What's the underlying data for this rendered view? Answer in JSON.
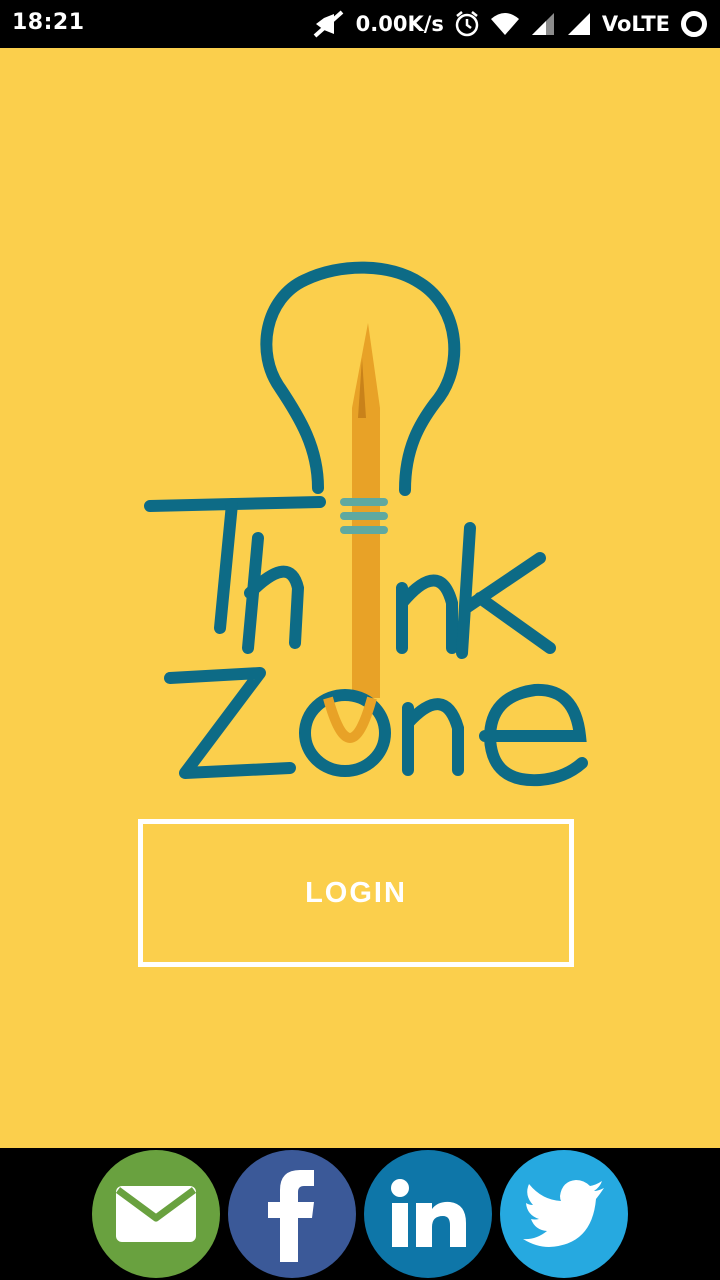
{
  "status_bar": {
    "time": "18:21",
    "net_speed": "0.00K/s",
    "network": "VoLTE",
    "icons": [
      "mute-icon",
      "alarm-icon",
      "wifi-icon",
      "signal-icon",
      "signal-icon",
      "circle-icon"
    ]
  },
  "logo": {
    "alt": "Think Zone",
    "colors": {
      "teal": "#0d6b86",
      "orange": "#e8a227"
    }
  },
  "login": {
    "label": "LOGIN"
  },
  "social": {
    "items": [
      {
        "name": "email",
        "icon": "envelope-icon",
        "color": "#69a13f"
      },
      {
        "name": "facebook",
        "icon": "facebook-icon",
        "color": "#3b5998"
      },
      {
        "name": "linkedin",
        "icon": "linkedin-icon",
        "color": "#0e76a8"
      },
      {
        "name": "twitter",
        "icon": "twitter-icon",
        "color": "#26a9e0"
      }
    ]
  },
  "colors": {
    "background": "#fbcf4c",
    "bars": "#000000",
    "button_border": "#ffffff"
  }
}
